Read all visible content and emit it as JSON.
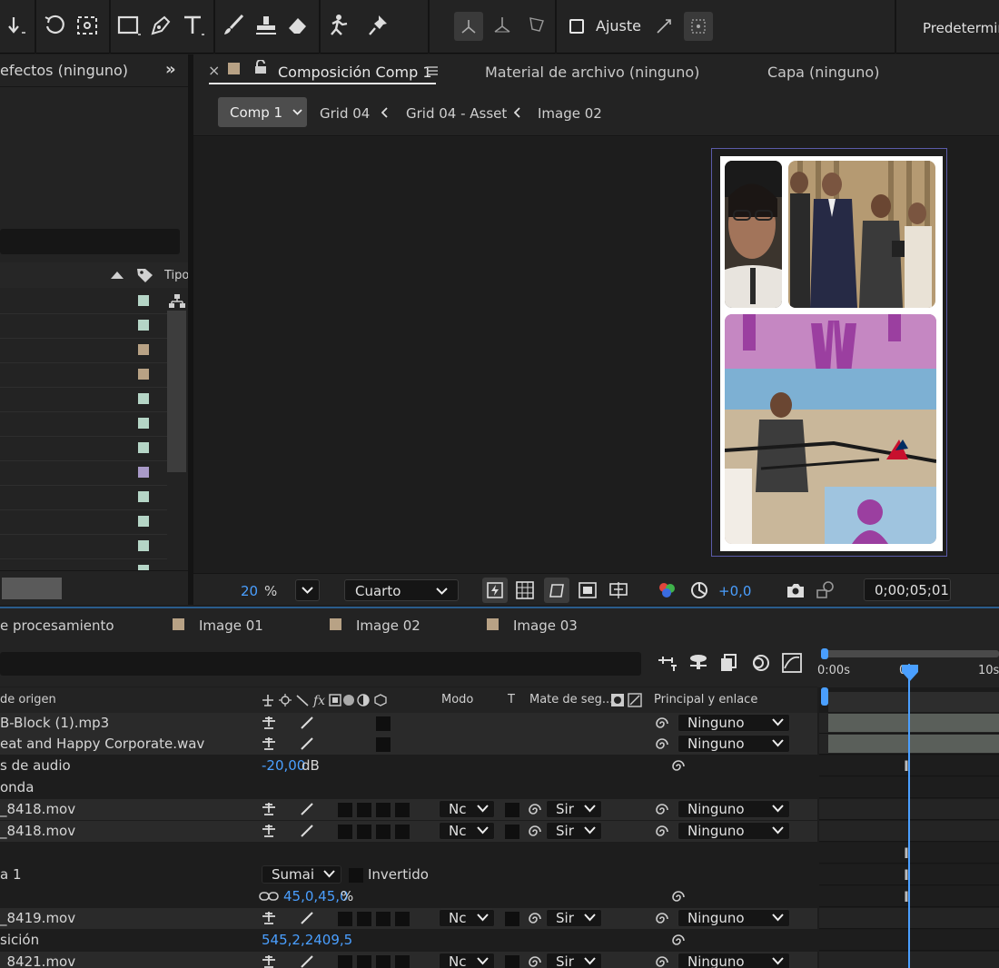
{
  "toolbar": {
    "ajuste_label": "Ajuste",
    "workspace_label": "Predetermin",
    "icons": [
      "arrow-down-icon",
      "rotate-icon",
      "anchor-grid-icon",
      "rectangle-icon",
      "pen-icon",
      "text-icon",
      "brush-icon",
      "stamp-icon",
      "eraser-icon",
      "roto-brush-icon",
      "puppet-pin-icon",
      "axis-world-icon",
      "axis-local-icon",
      "axis-view-icon",
      "snap-icon",
      "snap-grid-icon"
    ]
  },
  "left_panel": {
    "tab_label": "efectos (ninguno)",
    "expand_label": "»",
    "type_header": "Tipo",
    "swatch_colors": [
      "#b5d5c6",
      "#b5d5c6",
      "#b8a285",
      "#b8a285",
      "#b5d5c6",
      "#b5d5c6",
      "#b5d5c6",
      "#a99ac8",
      "#b5d5c6",
      "#b5d5c6",
      "#b5d5c6",
      "#b5d5c6"
    ]
  },
  "comp_panel": {
    "tab_close": "×",
    "tab_active": "Composición Comp 1",
    "tab_footage": "Material de archivo (ninguno)",
    "tab_layer": "Capa (ninguno)",
    "comp_dropdown": "Comp 1",
    "breadcrumbs": [
      "Grid 04",
      "Grid 04 - Asset",
      "Image 02"
    ],
    "zoom_value": "20",
    "zoom_unit": "%",
    "resolution": "Cuarto",
    "exposure": "+0,0",
    "timecode": "0;00;05;01"
  },
  "timeline": {
    "tabs": [
      "e procesamiento",
      "Image 01",
      "Image 02",
      "Image 03"
    ],
    "tab_color": "#b8a285",
    "columns": {
      "source": "de origen",
      "mode": "Modo",
      "t": "T",
      "matte": "Mate de seg...",
      "parent": "Principal y enlace"
    },
    "ruler": {
      "start": "0:00s",
      "mid": "05",
      "end": "10s"
    },
    "layers": {
      "r1": {
        "name": "B-Block (1).mp3",
        "parent": "Ninguno"
      },
      "r2": {
        "name": "eat and Happy Corporate.wav",
        "parent": "Ninguno"
      },
      "r3": {
        "name": "s de audio",
        "value": "-20,00",
        "unit": "dB"
      },
      "r4": {
        "name": "onda"
      },
      "r5": {
        "name": "_8418.mov",
        "mode": "Nc",
        "matte": "Sir",
        "parent": "Ninguno"
      },
      "r6": {
        "name": "_8418.mov",
        "mode": "Nc",
        "matte": "Sir",
        "parent": "Ninguno"
      },
      "r8": {
        "name": "a 1",
        "mask_mode": "Sumai",
        "inverted": "Invertido"
      },
      "r9": {
        "value": "45,0,45,0",
        "unit": "%"
      },
      "r10": {
        "name": "_8419.mov",
        "mode": "Nc",
        "matte": "Sir",
        "parent": "Ninguno"
      },
      "r11": {
        "name": "sición",
        "value": "545,2,2409,5"
      },
      "r12": {
        "name": "_8421.mov",
        "mode": "Nc",
        "matte": "Sir",
        "parent": "Ninguno"
      }
    }
  }
}
